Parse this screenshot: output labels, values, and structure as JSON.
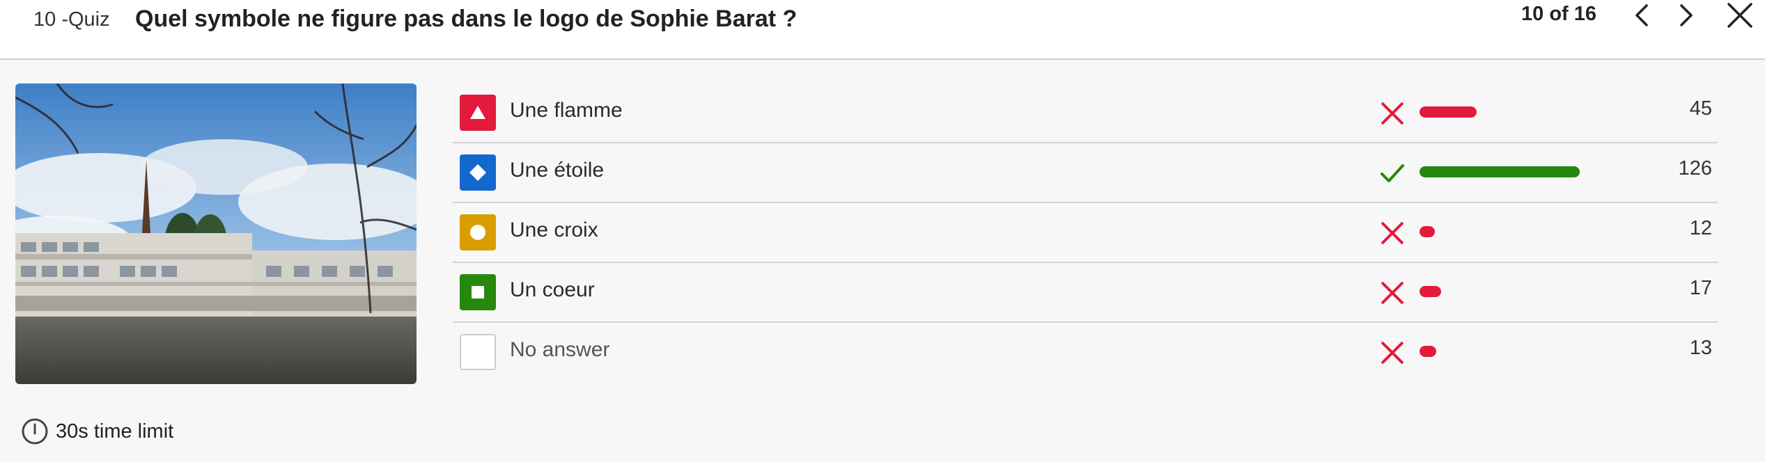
{
  "header": {
    "quiz_label": "10 -Quiz",
    "question": "Quel symbole ne figure pas dans le logo de Sophie Barat ?",
    "counter": "10 of 16"
  },
  "answers": [
    {
      "label": "Une flamme",
      "shape": "triangle-icon",
      "color": "#e21b3c",
      "correct": false,
      "count": "45",
      "value": 45
    },
    {
      "label": "Une étoile",
      "shape": "diamond-icon",
      "color": "#1368ce",
      "correct": true,
      "count": "126",
      "value": 126
    },
    {
      "label": "Une croix",
      "shape": "circle-icon",
      "color": "#d89e00",
      "correct": false,
      "count": "12",
      "value": 12
    },
    {
      "label": "Un coeur",
      "shape": "square-icon",
      "color": "#26890c",
      "correct": false,
      "count": "17",
      "value": 17
    },
    {
      "label": "No answer",
      "shape": "none",
      "color": "#ffffff",
      "correct": false,
      "count": "13",
      "value": 13
    }
  ],
  "colors": {
    "wrong": "#e21b3c",
    "correct": "#26890c"
  },
  "footer": {
    "time_limit": "30s time limit"
  }
}
